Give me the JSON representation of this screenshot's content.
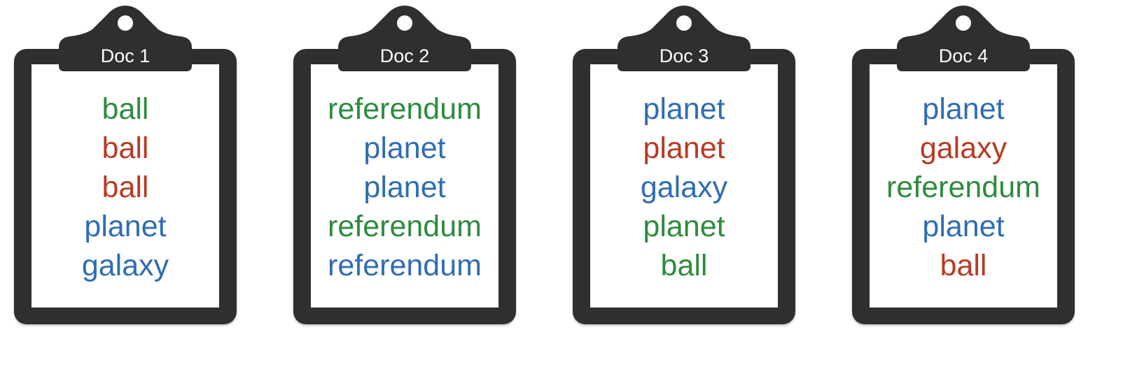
{
  "colors": {
    "green": "#2e8b3e",
    "red": "#b83a22",
    "blue": "#2f6db3",
    "board": "#2f2f2f"
  },
  "docs": [
    {
      "label": "Doc 1",
      "words": [
        {
          "text": "ball",
          "color": "green"
        },
        {
          "text": "ball",
          "color": "red"
        },
        {
          "text": "ball",
          "color": "red"
        },
        {
          "text": "planet",
          "color": "blue"
        },
        {
          "text": "galaxy",
          "color": "blue"
        }
      ]
    },
    {
      "label": "Doc 2",
      "words": [
        {
          "text": "referendum",
          "color": "green"
        },
        {
          "text": "planet",
          "color": "blue"
        },
        {
          "text": "planet",
          "color": "blue"
        },
        {
          "text": "referendum",
          "color": "green"
        },
        {
          "text": "referendum",
          "color": "blue"
        }
      ]
    },
    {
      "label": "Doc 3",
      "words": [
        {
          "text": "planet",
          "color": "blue"
        },
        {
          "text": "planet",
          "color": "red"
        },
        {
          "text": "galaxy",
          "color": "blue"
        },
        {
          "text": "planet",
          "color": "green"
        },
        {
          "text": "ball",
          "color": "green"
        }
      ]
    },
    {
      "label": "Doc 4",
      "words": [
        {
          "text": "planet",
          "color": "blue"
        },
        {
          "text": "galaxy",
          "color": "red"
        },
        {
          "text": "referendum",
          "color": "green"
        },
        {
          "text": "planet",
          "color": "blue"
        },
        {
          "text": "ball",
          "color": "red"
        }
      ]
    }
  ]
}
